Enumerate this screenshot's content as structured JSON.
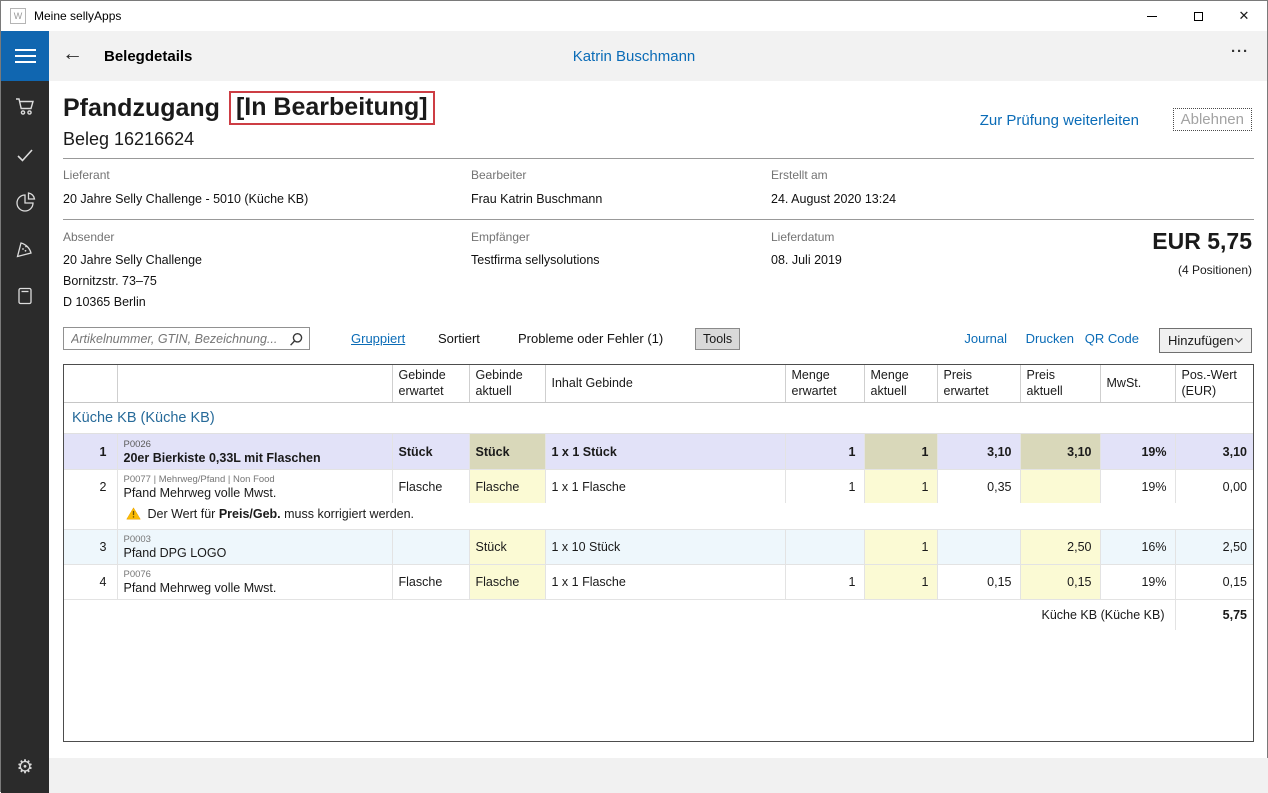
{
  "window": {
    "title": "Meine sellyApps",
    "app_icon_glyph": "W",
    "close_icon": "✕"
  },
  "header": {
    "back_icon": "←",
    "title": "Belegdetails",
    "user": "Katrin Buschmann",
    "more_icon": "···"
  },
  "sidebar": {
    "items": [
      "shopping-cart",
      "checkmark",
      "pie-chart",
      "pizza-slice",
      "book"
    ],
    "bottom_item": "settings-gear",
    "gear_glyph": "⚙"
  },
  "document": {
    "title": "Pfandzugang",
    "status": "[In Bearbeitung]",
    "subtitle": "Beleg 16216624",
    "action_forward": "Zur Prüfung weiterleiten",
    "action_reject": "Ablehnen",
    "info": {
      "lieferant_label": "Lieferant",
      "lieferant": "20 Jahre Selly Challenge - 5010 (Küche KB)",
      "bearbeiter_label": "Bearbeiter",
      "bearbeiter": "Frau Katrin Buschmann",
      "erstellt_label": "Erstellt am",
      "erstellt": "24. August 2020 13:24",
      "absender_label": "Absender",
      "absender_line1": "20 Jahre Selly Challenge",
      "absender_line2": "Bornitzstr. 73–75",
      "absender_line3": "D 10365 Berlin",
      "empfaenger_label": "Empfänger",
      "empfaenger": "Testfirma sellysolutions",
      "lieferdatum_label": "Lieferdatum",
      "lieferdatum": "08. Juli 2019"
    },
    "total_amount": "EUR 5,75",
    "total_positions": "(4 Positionen)"
  },
  "toolbar": {
    "search_placeholder": "Artikelnummer, GTIN, Bezeichnung...",
    "gruppiert": "Gruppiert",
    "sortiert": "Sortiert",
    "probleme": "Probleme oder Fehler (1)",
    "tools": "Tools",
    "journal": "Journal",
    "drucken": "Drucken",
    "qr_code": "QR Code",
    "hinzufuegen": "Hinzufügen"
  },
  "table": {
    "headers": [
      "",
      "",
      "Gebinde erwartet",
      "Gebinde aktuell",
      "Inhalt Gebinde",
      "Menge erwartet",
      "Menge aktuell",
      "Preis erwartet",
      "Preis aktuell",
      "MwSt.",
      "Pos.-Wert (EUR)"
    ],
    "group_title": "Küche KB (Küche KB)",
    "rows": [
      {
        "num": "1",
        "code": "P0026",
        "name": "20er Bierkiste 0,33L mit Flaschen",
        "gebinde_erwartet": "Stück",
        "gebinde_aktuell": "Stück",
        "inhalt_gebinde": "1 x 1 Stück",
        "menge_erwartet": "1",
        "menge_aktuell": "1",
        "preis_erwartet": "3,10",
        "preis_aktuell": "3,10",
        "mwst": "19%",
        "pos_wert": "3,10"
      },
      {
        "num": "2",
        "code": "P0077 | Mehrweg/Pfand | Non Food",
        "name": "Pfand Mehrweg volle Mwst.",
        "gebinde_erwartet": "Flasche",
        "gebinde_aktuell": "Flasche",
        "inhalt_gebinde": "1 x 1 Flasche",
        "menge_erwartet": "1",
        "menge_aktuell": "1",
        "preis_erwartet": "0,35",
        "preis_aktuell": "",
        "mwst": "19%",
        "pos_wert": "0,00"
      },
      {
        "num": "3",
        "code": "P0003",
        "name": "Pfand DPG LOGO",
        "gebinde_erwartet": "",
        "gebinde_aktuell": "Stück",
        "inhalt_gebinde": "1 x 10 Stück",
        "menge_erwartet": "",
        "menge_aktuell": "1",
        "preis_erwartet": "",
        "preis_aktuell": "2,50",
        "mwst": "16%",
        "pos_wert": "2,50"
      },
      {
        "num": "4",
        "code": "P0076",
        "name": "Pfand Mehrweg volle Mwst.",
        "gebinde_erwartet": "Flasche",
        "gebinde_aktuell": "Flasche",
        "inhalt_gebinde": "1 x 1 Flasche",
        "menge_erwartet": "1",
        "menge_aktuell": "1",
        "preis_erwartet": "0,15",
        "preis_aktuell": "0,15",
        "mwst": "19%",
        "pos_wert": "0,15"
      }
    ],
    "warning": {
      "prefix": "Der Wert für ",
      "field": "Preis/Geb.",
      "suffix": " muss korrigiert werden."
    },
    "group_total_label": "Küche KB (Küche KB)",
    "group_total_value": "5,75"
  },
  "colors": {
    "accent_blue": "#0b6cb7",
    "hamburger_blue": "#1066b0",
    "sidebar_bg": "#2b2b2b",
    "status_border_red": "#cd3d44",
    "selected_row_bg": "#e2e2f8",
    "selected_edit_cell_bg": "#d9d8ba",
    "editable_cell_bg": "#fbfad4",
    "alt_row_bg": "#eef7fc",
    "group_title_blue": "#266a99",
    "warning_yellow": "#fbbc04"
  }
}
